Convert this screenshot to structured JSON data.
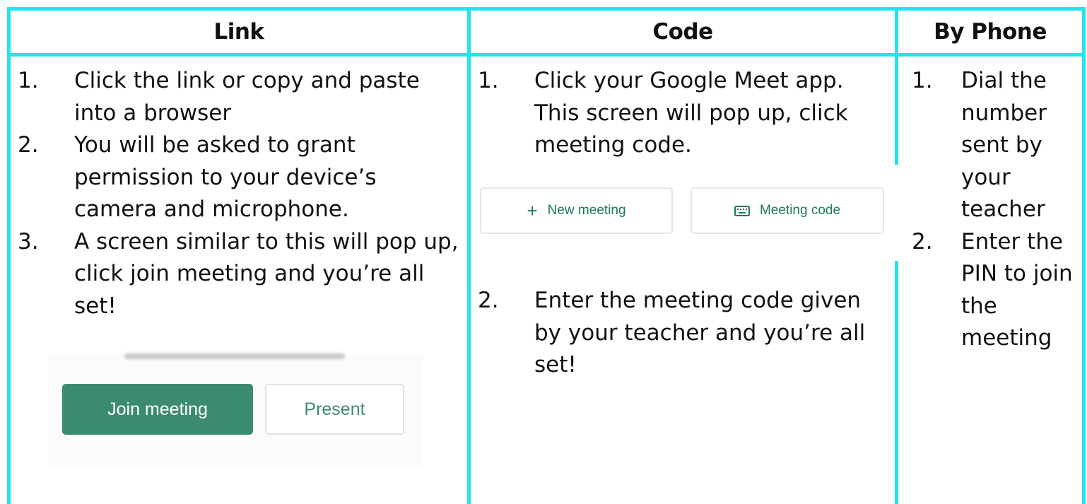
{
  "headers": {
    "link": "Link",
    "code": "Code",
    "phone": "By Phone"
  },
  "link_steps": [
    {
      "num": "1.",
      "text": "Click the link or copy and paste into a browser"
    },
    {
      "num": "2.",
      "text": "You will be asked to grant permission to your device’s camera and microphone."
    },
    {
      "num": "3.",
      "text": "A screen similar to this will pop up, click join meeting and you’re all set!"
    }
  ],
  "code_steps": [
    {
      "num": "1.",
      "text": "Click your Google Meet app. This screen will pop up, click meeting code."
    },
    {
      "num": "2.",
      "text": "Enter the meeting code given by your teacher and you’re all set!"
    }
  ],
  "phone_steps": [
    {
      "num": "1.",
      "text": "Dial the number sent by your teacher"
    },
    {
      "num": "2.",
      "text": "Enter the PIN to join the meeting"
    }
  ],
  "meet_join_screenshot": {
    "join_label": "Join meeting",
    "present_label": "Present",
    "accent_color": "#3d8a73"
  },
  "meet_code_screenshot": {
    "new_meeting_label": "New meeting",
    "meeting_code_label": "Meeting code",
    "plus_symbol": "+",
    "accent_color": "#1a7a5a"
  },
  "colors": {
    "grid": "#25e3ec",
    "text": "#111111"
  }
}
